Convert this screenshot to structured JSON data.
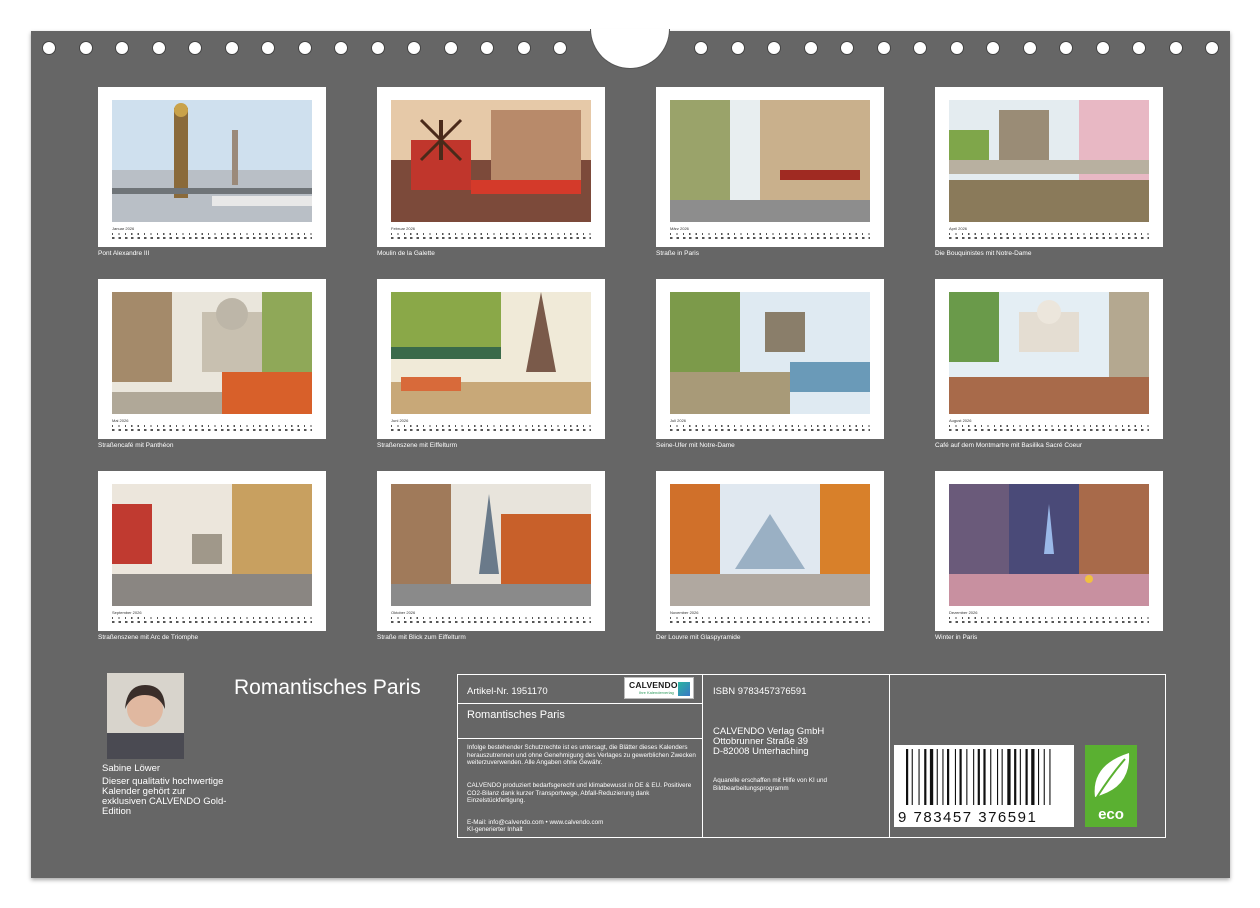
{
  "months": [
    {
      "label": "Januar 2026",
      "caption": "Pont Alexandre III"
    },
    {
      "label": "Februar 2026",
      "caption": "Moulin de la Galette"
    },
    {
      "label": "März 2026",
      "caption": "Straße in Paris"
    },
    {
      "label": "April 2026",
      "caption": "Die Bouquinistes mit Notre-Dame"
    },
    {
      "label": "Mai 2026",
      "caption": "Straßencafé mit Panthéon"
    },
    {
      "label": "Juni 2026",
      "caption": "Straßenszene mit Eiffelturm"
    },
    {
      "label": "Juli 2026",
      "caption": "Seine-Ufer mit Notre-Dame"
    },
    {
      "label": "August 2026",
      "caption": "Café auf dem Montmartre mit Basilika Sacré Coeur"
    },
    {
      "label": "September 2026",
      "caption": "Straßenszene mit Arc de Triomphe"
    },
    {
      "label": "Oktober 2026",
      "caption": "Straße mit Blick zum Eiffelturm"
    },
    {
      "label": "November 2026",
      "caption": "Der Louvre mit Glaspyramide"
    },
    {
      "label": "Dezember 2026",
      "caption": "Winter in Paris"
    }
  ],
  "author": {
    "name": "Sabine Löwer",
    "note": "Dieser qualitativ hochwertige Kalender gehört zur exklusiven CALVENDO Gold-Edition"
  },
  "title": "Romantisches Paris",
  "info": {
    "article": "Artikel-Nr. 1951170",
    "product_title": "Romantisches Paris",
    "legal": "Infolge bestehender Schutzrechte ist es untersagt, die Blätter dieses Kalenders herauszutrennen und ohne Genehmigung des Verlages zu gewerblichen Zwecken weiterzuverwenden. Alle Angaben ohne Gewähr.",
    "climate": "CALVENDO produziert bedarfsgerecht und klimabewusst in DE & EU. Positivere CO2-Bilanz dank kurzer Transportwege, Abfall-Reduzierung dank Einzelstückfertigung.",
    "contact": "E-Mail: info@calvendo.com • www.calvendo.com",
    "ki": "KI-generierter Inhalt",
    "isbn": "ISBN 9783457376591",
    "publisher_1": "CALVENDO Verlag GmbH",
    "publisher_2": "Ottobrunner Straße 39",
    "publisher_3": "D-82008 Unterhaching",
    "ki_note": "Aquarelle erschaffen mit Hilfe von KI und Bildbearbeitungsprogramm",
    "barcode_digits": "9 783457 376591",
    "eco": "eco"
  },
  "logo": {
    "name": "CALVENDO",
    "tagline": "Ihre Kalenderverlag"
  },
  "colors": {
    "board": "#666666",
    "eco_green": "#5ab031",
    "logo_accent": "#2bb5a0"
  }
}
